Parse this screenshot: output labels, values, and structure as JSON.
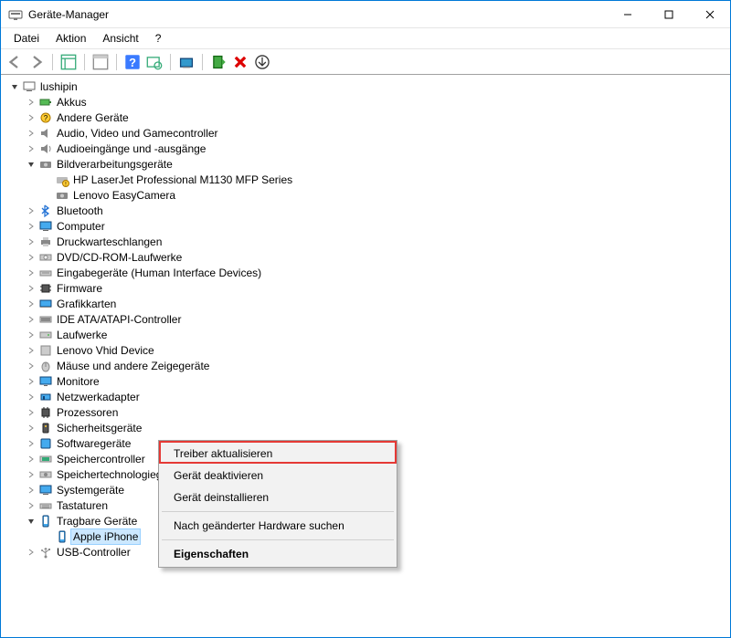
{
  "window": {
    "title": "Geräte-Manager"
  },
  "menu": {
    "file": "Datei",
    "action": "Aktion",
    "view": "Ansicht",
    "help": "?"
  },
  "tree": {
    "root": "lushipin",
    "akkus": "Akkus",
    "andere": "Andere Geräte",
    "audio_video": "Audio, Video und Gamecontroller",
    "audio_io": "Audioeingänge und -ausgänge",
    "imaging": "Bildverarbeitungsgeräte",
    "hp_printer": "HP LaserJet Professional M1130 MFP Series",
    "lenovo_cam": "Lenovo EasyCamera",
    "bluetooth": "Bluetooth",
    "computer": "Computer",
    "print_queues": "Druckwarteschlangen",
    "dvd": "DVD/CD-ROM-Laufwerke",
    "hid": "Eingabegeräte (Human Interface Devices)",
    "firmware": "Firmware",
    "gpu": "Grafikkarten",
    "ide": "IDE ATA/ATAPI-Controller",
    "drives": "Laufwerke",
    "lenovo_vhid": "Lenovo Vhid Device",
    "mice": "Mäuse und andere Zeigegeräte",
    "monitors": "Monitore",
    "net": "Netzwerkadapter",
    "cpu": "Prozessoren",
    "security": "Sicherheitsgeräte",
    "software_dev": "Softwaregeräte",
    "storage_ctrl": "Speichercontroller",
    "storage_tech": "Speichertechnologiegeräte",
    "system": "Systemgeräte",
    "keyboards": "Tastaturen",
    "portable": "Tragbare Geräte",
    "apple_iphone": "Apple iPhone",
    "usb": "USB-Controller"
  },
  "context_menu": {
    "update_driver": "Treiber aktualisieren",
    "disable_device": "Gerät deaktivieren",
    "uninstall_device": "Gerät deinstallieren",
    "scan_hardware": "Nach geänderter Hardware suchen",
    "properties": "Eigenschaften"
  }
}
